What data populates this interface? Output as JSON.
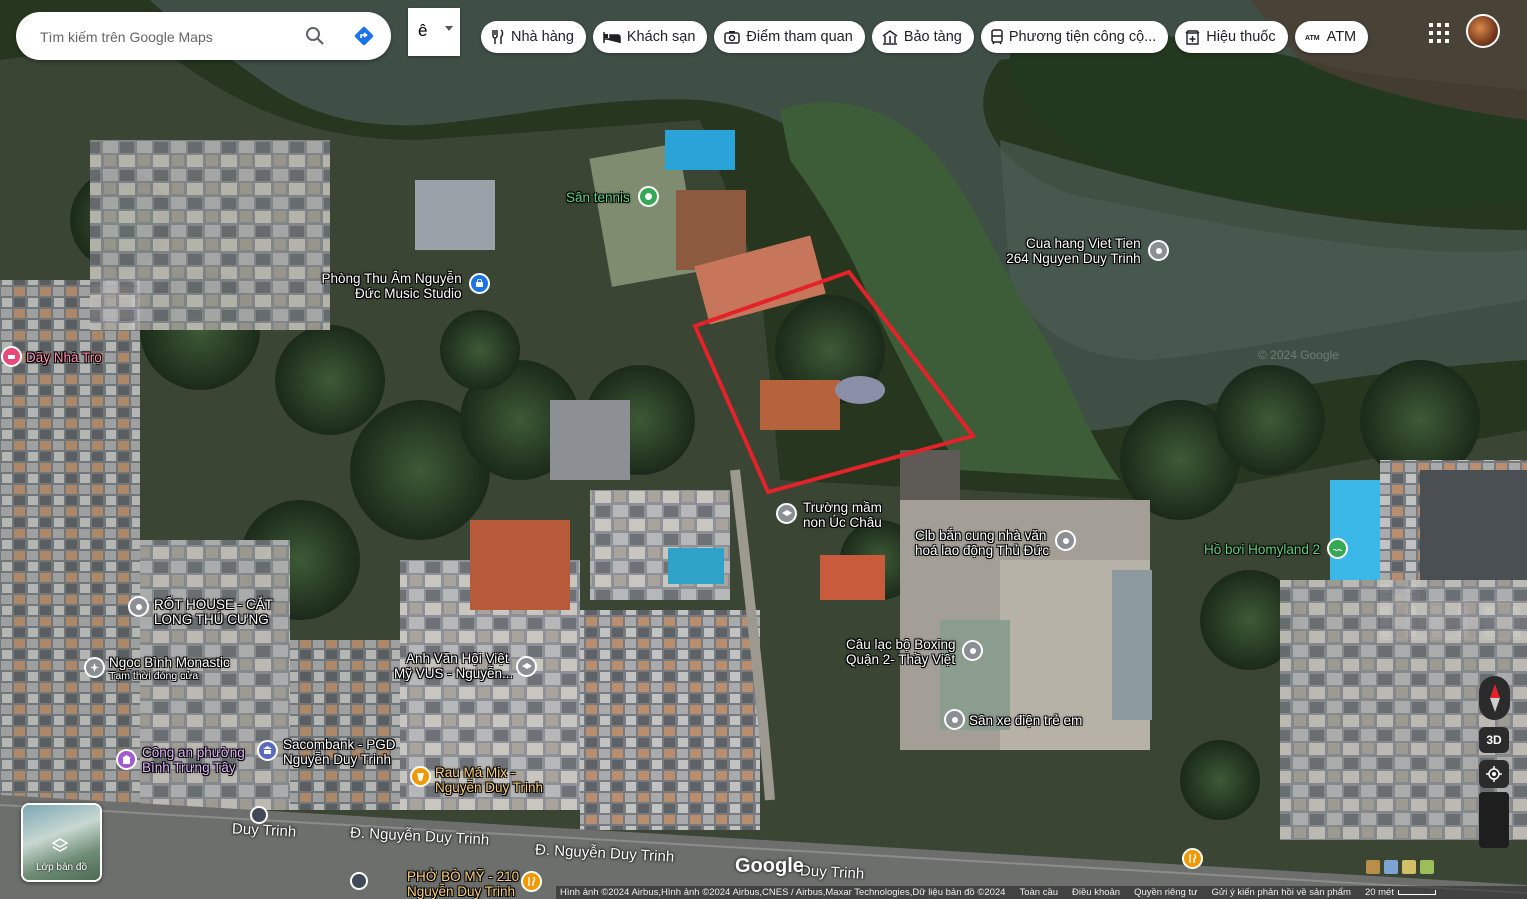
{
  "search": {
    "placeholder": "Tìm kiếm trên Google Maps"
  },
  "language_box": {
    "text": "ê"
  },
  "chips": [
    {
      "label": "Nhà hàng",
      "icon": "restaurant-icon"
    },
    {
      "label": "Khách sạn",
      "icon": "hotel-icon"
    },
    {
      "label": "Điểm tham quan",
      "icon": "camera-icon"
    },
    {
      "label": "Bảo tàng",
      "icon": "museum-icon"
    },
    {
      "label": "Phương tiện công cộ...",
      "icon": "transit-icon"
    },
    {
      "label": "Hiệu thuốc",
      "icon": "pharmacy-icon"
    },
    {
      "label": "ATM",
      "icon": "atm-icon"
    }
  ],
  "places": [
    {
      "name": "Sân tennis",
      "color": "#34a853",
      "icon": "tennis-icon"
    },
    {
      "name": "Phòng Thu Âm Nguyễn Đức Music Studio",
      "line1": "Phòng Thu Âm Nguyễn",
      "line2": "Đức Music Studio",
      "color": "#1a73e8",
      "icon": "music-icon"
    },
    {
      "name": "Dãy Nhà Trọ",
      "color": "#e8487a",
      "icon": "bed-icon"
    },
    {
      "name": "Cua hang Viet Tien 264 Nguyen Duy Trinh",
      "line1": "Cua hang Viet Tien",
      "line2": "264 Nguyen Duy Trinh",
      "color": "#8a8f94",
      "icon": "pin-dot-icon"
    },
    {
      "name": "Trường mầm non Úc Châu",
      "line1": "Trường mầm",
      "line2": "non Úc Châu",
      "color": "#8a8f94",
      "icon": "school-icon"
    },
    {
      "name": "Clb bắn cung nhà văn hoá lao động Thủ Đức",
      "line1": "Clb bắn cung nhà văn",
      "line2": "hoá lao động Thủ Đức",
      "color": "#8a8f94",
      "icon": "pin-dot-icon"
    },
    {
      "name": "Hồ bơi Homyland 2",
      "color": "#34a853",
      "icon": "pool-icon"
    },
    {
      "name": "RỐT HOUSE - CẮT LONG THÚ CƯNG",
      "line1": "RỐT HOUSE - CẮT",
      "line2": "LONG THÚ CƯNG",
      "color": "#8a8f94",
      "icon": "pin-dot-icon"
    },
    {
      "name": "Ngọc Bình Monastic",
      "line2": "Tạm thời đóng cửa",
      "color": "#8a8f94",
      "icon": "monastery-icon"
    },
    {
      "name": "Anh Văn Hội Việt Mỹ VUS - Nguyễn...",
      "line1": "Anh Văn Hội Việt",
      "line2": "Mỹ VUS - Nguyễn...",
      "color": "#8a8f94",
      "icon": "school-icon"
    },
    {
      "name": "Câu lạc bộ Boxing Quận 2- Thầy Việt",
      "line1": "Câu lạc bộ Boxing",
      "line2": "Quận 2- Thầy Việt",
      "color": "#8a8f94",
      "icon": "pin-dot-icon"
    },
    {
      "name": "Sân xe điện trẻ em",
      "color": "#8a8f94",
      "icon": "pin-dot-icon"
    },
    {
      "name": "Công an phường Bình Trưng Tây",
      "line1": "Công an phường",
      "line2": "Bình Trưng Tây",
      "color": "#a35bd0",
      "icon": "police-icon"
    },
    {
      "name": "Sacombank - PGD Nguyễn Duy Trinh",
      "line1": "Sacombank - PGD",
      "line2": "Nguyễn Duy Trinh",
      "color": "#5c6bc0",
      "icon": "bank-icon"
    },
    {
      "name": "Rau Má Mix - Nguyễn Duy Trinh",
      "line1": "Rau Má Mix -",
      "line2": "Nguyễn Duy Trinh",
      "color": "#f29900",
      "icon": "drink-icon"
    },
    {
      "name": "PHỞ BÒ MỸ - 210 Nguyễn Duy Trinh",
      "line1": "PHỞ BÒ MỸ - 210",
      "line2": "Nguyễn Duy Trinh",
      "color": "#f29900",
      "icon": "restaurant-icon"
    }
  ],
  "roads": [
    "Đ. Nguyễn Duy Trinh",
    "Đ. Nguyễn Duy Trinh",
    "Duy Trinh",
    "Duy Trinh"
  ],
  "watermark": "Google",
  "watermark_faint": "© 2024 Google",
  "layers_button": {
    "label": "Lớp bản đồ"
  },
  "controls": {
    "threeD": "3D"
  },
  "footer": {
    "imagery": "Hình ảnh ©2024 Airbus,Hình ảnh ©2024 Airbus,CNES / Airbus,Maxar Technologies,Dữ liệu bản đồ ©2024",
    "terms": "Toàn cầu",
    "privacy": "Điều khoản",
    "policy": "Quyền riêng tư",
    "feedback": "Gửi ý kiến phản hồi về sản phẩm",
    "scale": "20 mét"
  },
  "highlight_color": "#e3222a"
}
